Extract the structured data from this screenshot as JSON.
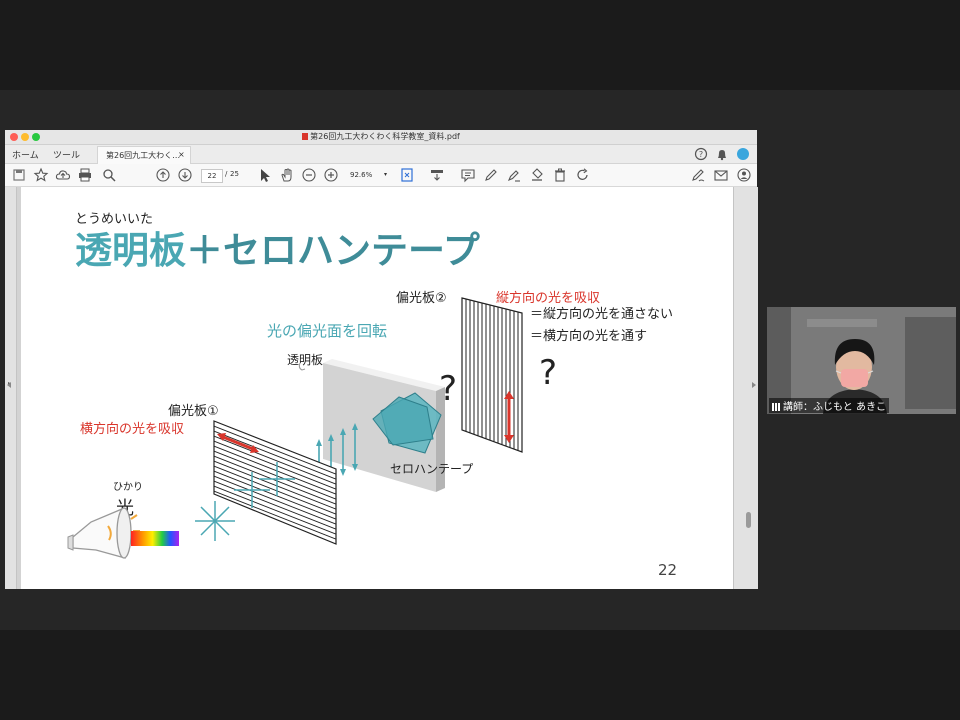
{
  "window": {
    "title": "第26回九工大わくわく科学教室_資料.pdf",
    "nav_home": "ホーム",
    "nav_tools": "ツール",
    "doc_tab": "第26回九工大わく…",
    "doc_tab_close": "×"
  },
  "toolbar": {
    "page_current": "22",
    "page_sep": "/",
    "page_total": "25",
    "zoom": "92.6%"
  },
  "slide": {
    "ruby": "とうめいいた",
    "title_kanji": "透明板",
    "title_rest": "＋セロハンテープ",
    "polarizer2_label": "偏光板②",
    "polarizer2_note": "縦方向の光を吸収",
    "eq1": "＝縦方向の光を通さない",
    "eq2": "＝横方向の光を通す",
    "rotate_note": "光の偏光面を回転",
    "transparent_plate": "透明板",
    "question1": "?",
    "question2": "?",
    "polarizer1_label": "偏光板①",
    "polarizer1_note": "横方向の光を吸収",
    "tape_label": "セロハンテープ",
    "light_ruby": "ひかり",
    "light_label": "光",
    "page_number": "22"
  },
  "video": {
    "label": "講師：ふじもと あきこ"
  },
  "colors": {
    "teal": "#4aa7b3",
    "red": "#d9352b"
  }
}
